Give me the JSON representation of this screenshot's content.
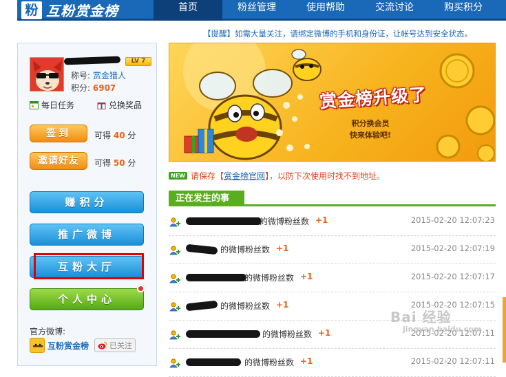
{
  "header": {
    "logo_char": "粉",
    "logo_text": "互粉赏金榜",
    "nav": [
      {
        "label": "首页",
        "active": true
      },
      {
        "label": "粉丝管理",
        "active": false
      },
      {
        "label": "使用帮助",
        "active": false
      },
      {
        "label": "交流讨论",
        "active": false
      },
      {
        "label": "购买积分",
        "active": false
      }
    ]
  },
  "notice": "【提醒】如需大量关注，请绑定微博的手机和身份证，让帐号达到安全状态。",
  "profile": {
    "level": "LV 7",
    "title_label": "称号:",
    "title_value": "赏金猎人",
    "score_label": "积分:",
    "score_value": "6907",
    "daily_task": "每日任务",
    "redeem_prize": "兑换奖品"
  },
  "actions": {
    "checkin_label": "签到",
    "checkin_prefix": "可得",
    "checkin_points": "40",
    "checkin_unit": "分",
    "invite_label": "邀请好友",
    "invite_prefix": "可得",
    "invite_points": "50",
    "invite_unit": "分"
  },
  "menu": {
    "earn": "赚积分",
    "promote": "推广微博",
    "hall": "互粉大厅",
    "center": "个人中心"
  },
  "official": {
    "label": "官方微博:",
    "name": "互粉赏金榜",
    "follow_status": "已关注"
  },
  "banner": {
    "title": "赏金榜升级了",
    "sub1": "积分换会员",
    "sub2": "快来体验吧!"
  },
  "save_notice": {
    "new_tag": "NEW",
    "prefix": "请保存【",
    "link": "赏金榜官网",
    "suffix": "】，以防下次使用时找不到地址。"
  },
  "happening": {
    "title": "正在发生的事",
    "rows": [
      {
        "text": "的微博粉丝数",
        "plus": "+1",
        "time": "2015-02-20 12:07:23"
      },
      {
        "text": "的微博粉丝数",
        "plus": "+1",
        "time": "2015-02-20 12:07:19"
      },
      {
        "text": "的微博粉丝数",
        "plus": "+1",
        "time": "2015-02-20 12:07:17"
      },
      {
        "text": "的微博粉丝数",
        "plus": "+1",
        "time": "2015-02-20 12:07:15"
      },
      {
        "text": "的微博粉丝数",
        "plus": "+1",
        "time": "2015-02-20 12:07:11"
      },
      {
        "text": "的微博粉丝数",
        "plus": "+1",
        "time": "2015-02-20 12:07:11"
      }
    ]
  },
  "watermark": {
    "logo": "Bai 经验",
    "sub": "jingyan.baidu.com"
  },
  "colors": {
    "header_blue": "#1a68b8",
    "accent_orange": "#e8631a",
    "feed_green": "#5aae1e",
    "highlight_red": "#e00000"
  }
}
